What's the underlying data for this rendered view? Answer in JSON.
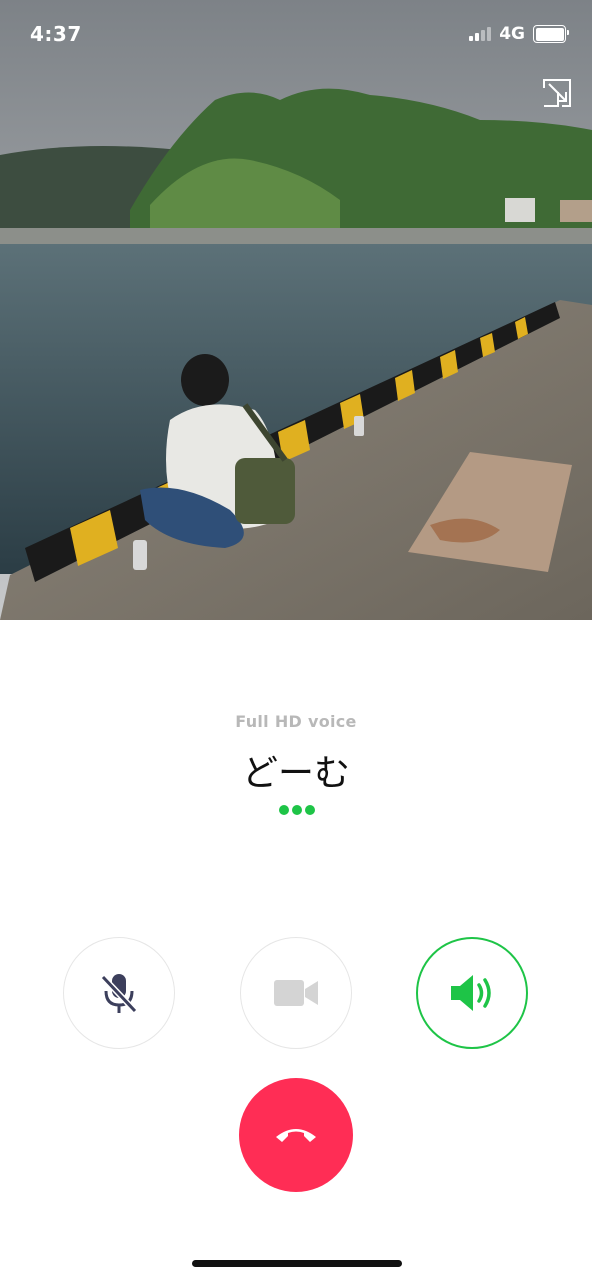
{
  "status_bar": {
    "time": "4:37",
    "network": "4G",
    "signal_bars_active": 2,
    "signal_bars_total": 4
  },
  "header": {
    "minimize_icon": "minimize-arrow-icon"
  },
  "call": {
    "quality_label": "Full HD voice",
    "caller_name": "どーむ",
    "connecting_indicator": "connecting-dots"
  },
  "controls": {
    "mute": {
      "icon": "microphone-muted-icon",
      "state": "muted"
    },
    "video": {
      "icon": "video-camera-icon",
      "state": "disabled"
    },
    "speaker": {
      "icon": "speaker-icon",
      "state": "on"
    },
    "end_call": {
      "icon": "end-call-icon"
    }
  },
  "colors": {
    "accent_green": "#1ec447",
    "end_call_red": "#ff2d55",
    "quality_gray": "#b8b8b8",
    "mute_icon": "#3c3f5c",
    "video_icon_disabled": "#d4d4d4"
  }
}
